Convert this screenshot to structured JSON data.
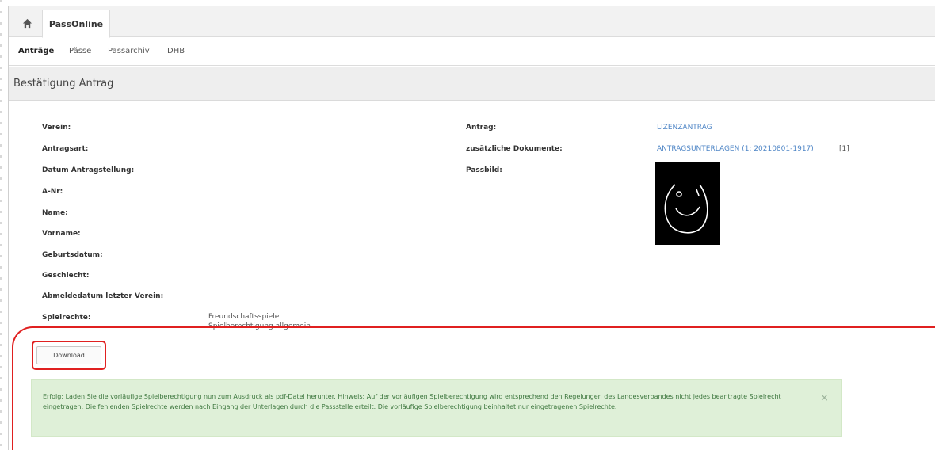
{
  "header": {
    "home_icon": "home-icon",
    "tab_label": "PassOnline"
  },
  "subnav": {
    "items": [
      {
        "label": "Anträge"
      },
      {
        "label": "Pässe"
      },
      {
        "label": "Passarchiv"
      },
      {
        "label": "DHB"
      }
    ]
  },
  "page": {
    "title": "Bestätigung Antrag"
  },
  "fields_left": [
    {
      "label": "Verein:"
    },
    {
      "label": "Antragsart:"
    },
    {
      "label": "Datum Antragstellung:"
    },
    {
      "label": "A-Nr:"
    },
    {
      "label": "Name:"
    },
    {
      "label": "Vorname:"
    },
    {
      "label": "Geburtsdatum:"
    },
    {
      "label": "Geschlecht:"
    },
    {
      "label": "Abmeldedatum letzter Verein:"
    },
    {
      "label": "Spielrechte:"
    }
  ],
  "spielrechte_values": [
    "Freundschaftsspiele",
    "Spielberechtigung allgemein"
  ],
  "fields_right": [
    {
      "label": "Antrag:",
      "value": "LIZENZANTRAG"
    },
    {
      "label": "zusätzliche Dokumente:",
      "value": "ANTRAGSUNTERLAGEN (1: 20210801-1917)",
      "suffix": "[1]"
    },
    {
      "label": "Passbild:"
    }
  ],
  "download": {
    "label": "Download"
  },
  "alert": {
    "text": "Erfolg: Laden Sie die vorläufige Spielberechtigung nun zum Ausdruck als pdf-Datei herunter. Hinweis: Auf der vorläufigen Spielberechtigung wird entsprechend den Regelungen des Landesverbandes nicht jedes beantragte Spielrecht eingetragen. Die fehlenden Spielrechte werden nach Eingang der Unterlagen durch die Passstelle erteilt. Die vorläufige Spielberechtigung beinhaltet nur eingetragenen Spielrechte.",
    "close_symbol": "×",
    "background": "#dff0d8",
    "text_color": "#3c763d"
  },
  "colors": {
    "link": "#4f86c6",
    "highlight": "#e02020"
  }
}
